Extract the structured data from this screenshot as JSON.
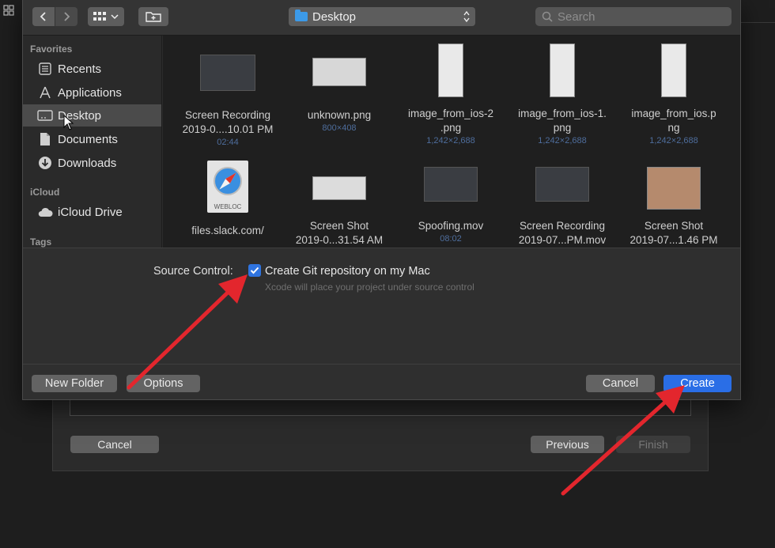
{
  "toolbar": {
    "location": "Desktop",
    "search_placeholder": "Search"
  },
  "sidebar": {
    "sections": [
      {
        "title": "Favorites"
      },
      {
        "title": "iCloud"
      },
      {
        "title": "Tags"
      }
    ],
    "items": [
      {
        "label": "Recents",
        "icon": "clock-icon"
      },
      {
        "label": "Applications",
        "icon": "applications-icon"
      },
      {
        "label": "Desktop",
        "icon": "desktop-icon",
        "selected": true
      },
      {
        "label": "Documents",
        "icon": "documents-icon"
      },
      {
        "label": "Downloads",
        "icon": "downloads-icon"
      },
      {
        "label": "iCloud Drive",
        "icon": "cloud-icon"
      }
    ]
  },
  "files": [
    {
      "name1": "Screen Recording",
      "name2": "2019-0....10.01 PM",
      "meta": "02:44"
    },
    {
      "name1": "unknown.png",
      "name2": "",
      "meta": "800×408"
    },
    {
      "name1": "image_from_ios-2",
      "name2": ".png",
      "meta": "1,242×2,688"
    },
    {
      "name1": "image_from_ios-1.",
      "name2": "png",
      "meta": "1,242×2,688"
    },
    {
      "name1": "image_from_ios.p",
      "name2": "ng",
      "meta": "1,242×2,688"
    },
    {
      "name1": "files.slack.com/",
      "name2": "",
      "meta": "",
      "badge": "WEBLOC"
    },
    {
      "name1": "Screen Shot",
      "name2": "2019-0...31.54 AM",
      "meta": ""
    },
    {
      "name1": "Spoofing.mov",
      "name2": "",
      "meta": "08:02"
    },
    {
      "name1": "Screen Recording",
      "name2": "2019-07...PM.mov",
      "meta": ""
    },
    {
      "name1": "Screen Shot",
      "name2": "2019-07...1.46 PM",
      "meta": ""
    }
  ],
  "options": {
    "source_control_label": "Source Control:",
    "git_checkbox_label": "Create Git repository on my Mac",
    "git_checkbox_checked": true,
    "git_hint": "Xcode will place your project under source control"
  },
  "footer": {
    "new_folder": "New Folder",
    "options": "Options",
    "cancel": "Cancel",
    "create": "Create"
  },
  "background_dialog": {
    "cancel": "Cancel",
    "previous": "Previous",
    "finish": "Finish"
  },
  "colors": {
    "accent": "#2a6ee6",
    "annotation_arrow": "#e3262d"
  }
}
